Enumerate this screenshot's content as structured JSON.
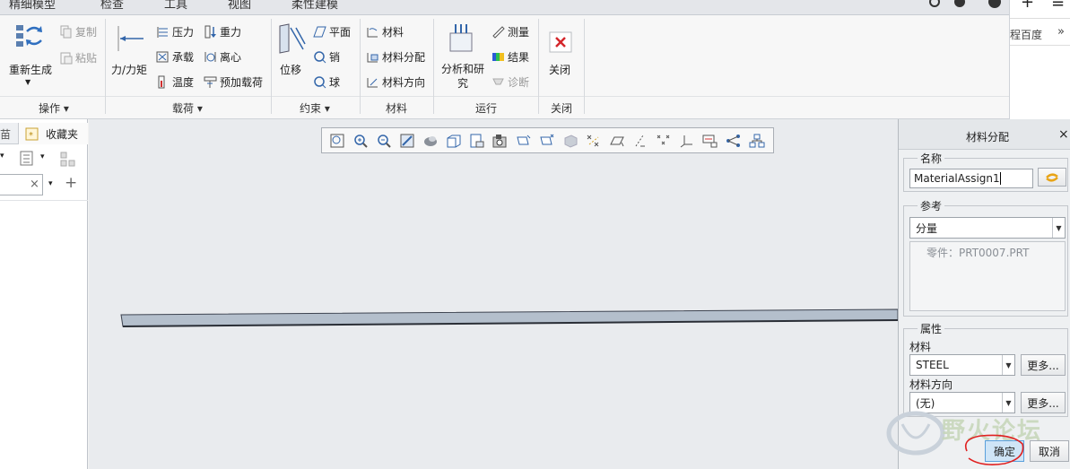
{
  "tabs": [
    "精细模型",
    "检查",
    "工具",
    "视图",
    "柔性建模"
  ],
  "ribbon": {
    "operations": {
      "regenerate": "重新生成",
      "copy": "复制",
      "paste": "粘贴",
      "group_label": "操作"
    },
    "loads": {
      "force_moment": "力/力矩",
      "pressure": "压力",
      "gravity": "重力",
      "bearing": "承载",
      "centrifugal": "离心",
      "temperature": "温度",
      "preload": "预加载荷",
      "group_label": "载荷"
    },
    "constraints": {
      "displacement": "位移",
      "plane": "平面",
      "pin": "销",
      "ball": "球",
      "group_label": "约束"
    },
    "materials": {
      "material": "材料",
      "material_assign": "材料分配",
      "material_orientation": "材料方向",
      "group_label": "材料"
    },
    "run": {
      "analyses_studies": "分析和研究",
      "measures": "测量",
      "results": "结果",
      "diagnostics": "诊断",
      "group_label": "运行"
    },
    "close": {
      "close": "关闭",
      "group_label": "关闭"
    }
  },
  "right_strip": {
    "browser_label": "程百度",
    "expand": "»",
    "plus": "+",
    "menu": "≡"
  },
  "left_panel": {
    "tab_partial": "苗",
    "favorites": "收藏夹",
    "search_clear": "×",
    "add": "+"
  },
  "dialog": {
    "title": "材料分配",
    "close": "×",
    "name_section": "名称",
    "name_value": "MaterialAssign1",
    "references_section": "参考",
    "reference_type": "分量",
    "reference_item": "零件：PRT0007.PRT",
    "properties_section": "属性",
    "material_label": "材料",
    "material_value": "STEEL",
    "more_button": "更多...",
    "orientation_label": "材料方向",
    "orientation_value": "(无)",
    "ok_button": "确定",
    "cancel_button": "取消"
  },
  "watermark": {
    "text": "野火论坛"
  },
  "colors": {
    "close_red": "#d4262b",
    "beam_fill": "#b4bfcc",
    "annotation_red": "#e02020",
    "ok_highlight": "#cfe5f7"
  }
}
